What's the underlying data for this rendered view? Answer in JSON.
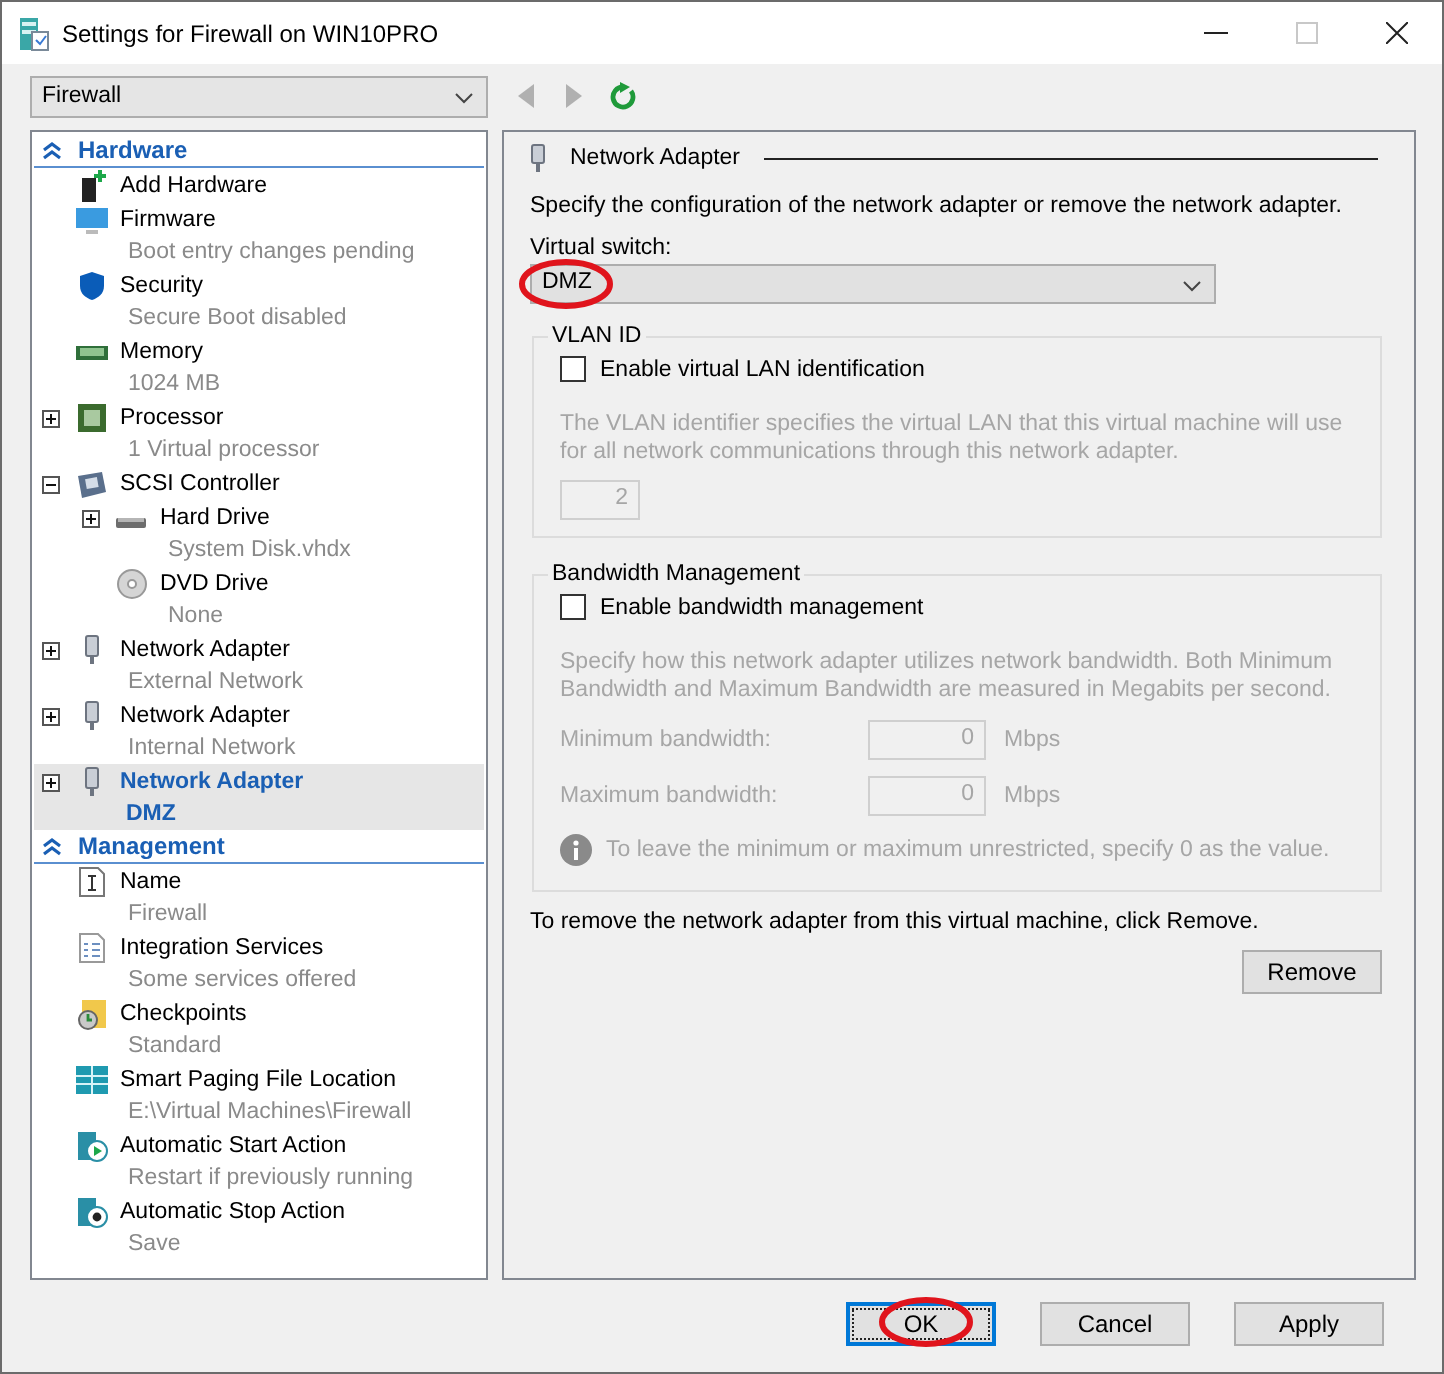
{
  "window": {
    "title": "Settings for Firewall on WIN10PRO"
  },
  "vm_selector": {
    "value": "Firewall"
  },
  "toolbar": [
    {
      "kind": "back",
      "disabled": true
    },
    {
      "kind": "forward",
      "disabled": true
    },
    {
      "kind": "refresh",
      "disabled": false
    }
  ],
  "sections": [
    {
      "title": "Hardware",
      "expanded": true,
      "items": [
        {
          "kind": "add-hardware",
          "label": "Add Hardware",
          "expandable": false,
          "selected": false
        },
        {
          "kind": "firmware",
          "label": "Firmware",
          "detail": "Boot entry changes pending",
          "expandable": false,
          "selected": false
        },
        {
          "kind": "security",
          "label": "Security",
          "detail": "Secure Boot disabled",
          "expandable": false,
          "selected": false
        },
        {
          "kind": "memory",
          "label": "Memory",
          "detail": "1024 MB",
          "expandable": false,
          "selected": false
        },
        {
          "kind": "processor",
          "label": "Processor",
          "detail": "1 Virtual processor",
          "expandable": true,
          "expanded": false,
          "selected": false
        },
        {
          "kind": "scsi",
          "label": "SCSI Controller",
          "expandable": true,
          "expanded": true,
          "selected": false,
          "children": [
            {
              "kind": "hard-drive",
              "label": "Hard Drive",
              "detail": "System Disk.vhdx",
              "expandable": true,
              "expanded": false,
              "selected": false
            },
            {
              "kind": "dvd",
              "label": "DVD Drive",
              "detail": "None",
              "expandable": false,
              "selected": false
            }
          ]
        },
        {
          "kind": "network-adapter",
          "label": "Network Adapter",
          "detail": "External Network",
          "expandable": true,
          "expanded": false,
          "selected": false
        },
        {
          "kind": "network-adapter",
          "label": "Network Adapter",
          "detail": "Internal Network",
          "expandable": true,
          "expanded": false,
          "selected": false
        },
        {
          "kind": "network-adapter",
          "label": "Network Adapter",
          "detail": "DMZ",
          "expandable": true,
          "expanded": false,
          "selected": true
        }
      ]
    },
    {
      "title": "Management",
      "expanded": true,
      "items": [
        {
          "kind": "name",
          "label": "Name",
          "detail": "Firewall",
          "expandable": false,
          "selected": false
        },
        {
          "kind": "integration",
          "label": "Integration Services",
          "detail": "Some services offered",
          "expandable": false,
          "selected": false
        },
        {
          "kind": "checkpoints",
          "label": "Checkpoints",
          "detail": "Standard",
          "expandable": false,
          "selected": false
        },
        {
          "kind": "paging",
          "label": "Smart Paging File Location",
          "detail": "E:\\Virtual Machines\\Firewall",
          "expandable": false,
          "selected": false
        },
        {
          "kind": "start-action",
          "label": "Automatic Start Action",
          "detail": "Restart if previously running",
          "expandable": false,
          "selected": false
        },
        {
          "kind": "stop-action",
          "label": "Automatic Stop Action",
          "detail": "Save",
          "expandable": false,
          "selected": false
        }
      ]
    }
  ],
  "details": {
    "heading": "Network Adapter",
    "description": "Specify the configuration of the network adapter or remove the network adapter.",
    "virtual_switch": {
      "label": "Virtual switch:",
      "value": "DMZ",
      "annotated": true
    },
    "vlan": {
      "title": "VLAN ID",
      "checkbox": {
        "label": "Enable virtual LAN identification",
        "checked": false
      },
      "description": "The VLAN identifier specifies the virtual LAN that this virtual machine will use for all network communications through this network adapter.",
      "value": "2"
    },
    "bandwidth": {
      "title": "Bandwidth Management",
      "checkbox": {
        "label": "Enable bandwidth management",
        "checked": false
      },
      "description": "Specify how this network adapter utilizes network bandwidth. Both Minimum Bandwidth and Maximum Bandwidth are measured in Megabits per second.",
      "fields": [
        {
          "label": "Minimum bandwidth:",
          "value": "0",
          "unit": "Mbps"
        },
        {
          "label": "Maximum bandwidth:",
          "value": "0",
          "unit": "Mbps"
        }
      ],
      "note": "To leave the minimum or maximum unrestricted, specify 0 as the value."
    },
    "remove_text": "To remove the network adapter from this virtual machine, click Remove.",
    "remove_button": "Remove"
  },
  "buttons": [
    {
      "label": "OK",
      "default": true,
      "annotated": true
    },
    {
      "label": "Cancel",
      "default": false,
      "annotated": false
    },
    {
      "label": "Apply",
      "default": false,
      "annotated": false
    }
  ]
}
